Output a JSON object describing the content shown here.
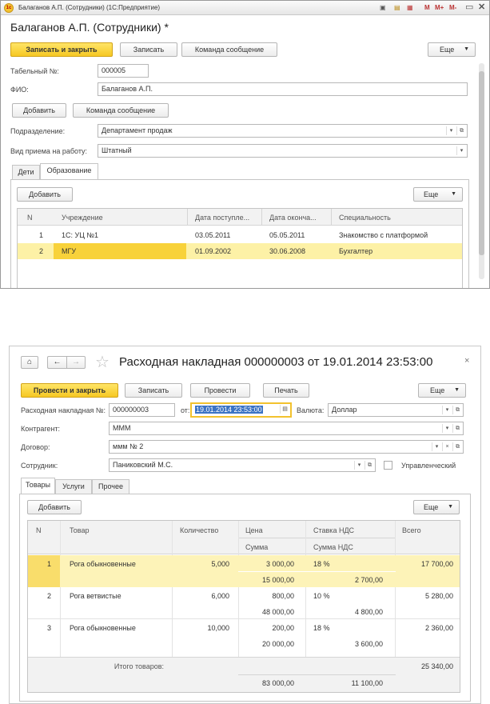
{
  "win1": {
    "title": "Балаганов А.П. (Сотрудники) (1С:Предприятие)",
    "titlebar_icons": [
      "М",
      "М+",
      "М-"
    ],
    "heading": "Балаганов А.П. (Сотрудники) *",
    "btn_save_close": "Записать и закрыть",
    "btn_save": "Записать",
    "btn_command": "Команда сообщение",
    "btn_more": "Еще",
    "label_tabnum": "Табельный №:",
    "tabnum": "000005",
    "label_fio": "ФИО:",
    "fio": "Балаганов А.П.",
    "btn_add": "Добавить",
    "btn_command2": "Команда сообщение",
    "label_dept": "Подразделение:",
    "dept": "Департамент продаж",
    "label_hire": "Вид приема на работу:",
    "hire": "Штатный",
    "tabs": [
      "Дети",
      "Образование"
    ],
    "tab_add": "Добавить",
    "tab_more": "Еще",
    "columns": [
      "N",
      "Учреждение",
      "Дата поступле...",
      "Дата оконча...",
      "Специальность"
    ],
    "rows": [
      {
        "n": "1",
        "inst": "1С: УЦ №1",
        "start": "03.05.2011",
        "end": "05.05.2011",
        "spec": "Знакомство с платформой"
      },
      {
        "n": "2",
        "inst": "МГУ",
        "start": "01.09.2002",
        "end": "30.06.2008",
        "spec": "Бухгалтер"
      }
    ]
  },
  "win2": {
    "heading": "Расходная накладная 000000003 от 19.01.2014 23:53:00",
    "btn_post_close": "Провести и закрыть",
    "btn_save": "Записать",
    "btn_post": "Провести",
    "btn_print": "Печать",
    "btn_more": "Еще",
    "label_num": "Расходная накладная №:",
    "num": "000000003",
    "label_from": "от:",
    "date": "19.01.2014 23:53:00",
    "label_currency": "Валюта:",
    "currency": "Доллар",
    "label_contractor": "Контрагент:",
    "contractor": "МММ",
    "label_contract": "Договор:",
    "contract": "ммм № 2",
    "label_employee": "Сотрудник:",
    "employee": "Паниковский М.С.",
    "label_mgmt": "Управленческий",
    "tabs": [
      "Товары",
      "Услуги",
      "Прочее"
    ],
    "tab_add": "Добавить",
    "tab_more": "Еще",
    "col_n": "N",
    "col_item": "Товар",
    "col_qty": "Количество",
    "col_price": "Цена",
    "col_sum": "Сумма",
    "col_vat_rate": "Ставка НДС",
    "col_vat_sum": "Сумма НДС",
    "col_total": "Всего",
    "rows": [
      {
        "n": "1",
        "item": "Рога обыкновенные",
        "qty": "5,000",
        "price": "3 000,00",
        "sum": "15 000,00",
        "rate": "18 %",
        "vat": "2 700,00",
        "total": "17 700,00"
      },
      {
        "n": "2",
        "item": "Рога ветвистые",
        "qty": "6,000",
        "price": "800,00",
        "sum": "48 000,00",
        "rate": "10 %",
        "vat": "4 800,00",
        "total": "5 280,00"
      },
      {
        "n": "3",
        "item": "Рога обыкновенные",
        "qty": "10,000",
        "price": "200,00",
        "sum": "20 000,00",
        "rate": "18 %",
        "vat": "3 600,00",
        "total": "2 360,00"
      }
    ],
    "footer_label": "Итого товаров:",
    "footer_sum": "83 000,00",
    "footer_vat": "11 100,00",
    "footer_total": "25 340,00"
  }
}
